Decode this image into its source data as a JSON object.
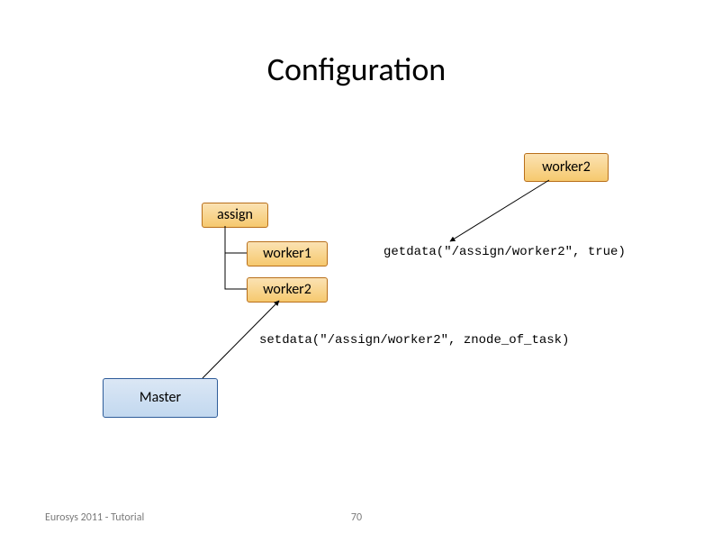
{
  "title": "Configuration",
  "nodes": {
    "worker2_top": "worker2",
    "assign": "assign",
    "worker1": "worker1",
    "worker2_child": "worker2",
    "master": "Master"
  },
  "code": {
    "getdata": "getdata(\"/assign/worker2\", true)",
    "setdata": "setdata(\"/assign/worker2\", znode_of_task)"
  },
  "footer": {
    "left": "Eurosys 2011 - Tutorial",
    "page": "70"
  }
}
